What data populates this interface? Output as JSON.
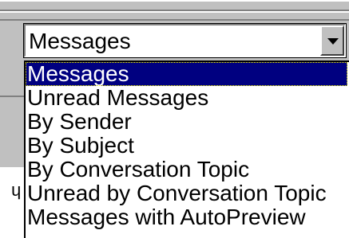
{
  "combo": {
    "value": "Messages",
    "arrow_icon": "chevron-down-icon"
  },
  "dropdown": {
    "options": [
      {
        "label": "Messages",
        "selected": true
      },
      {
        "label": "Unread Messages",
        "selected": false
      },
      {
        "label": "By Sender",
        "selected": false
      },
      {
        "label": "By Subject",
        "selected": false
      },
      {
        "label": "By Conversation Topic",
        "selected": false
      },
      {
        "label": "Unread by Conversation Topic",
        "selected": false
      },
      {
        "label": "Messages with AutoPreview",
        "selected": false
      }
    ]
  },
  "left_glyph": "ɥ",
  "colors": {
    "face": "#c0c0c0",
    "highlight": "#000080",
    "shadow": "#808080"
  }
}
